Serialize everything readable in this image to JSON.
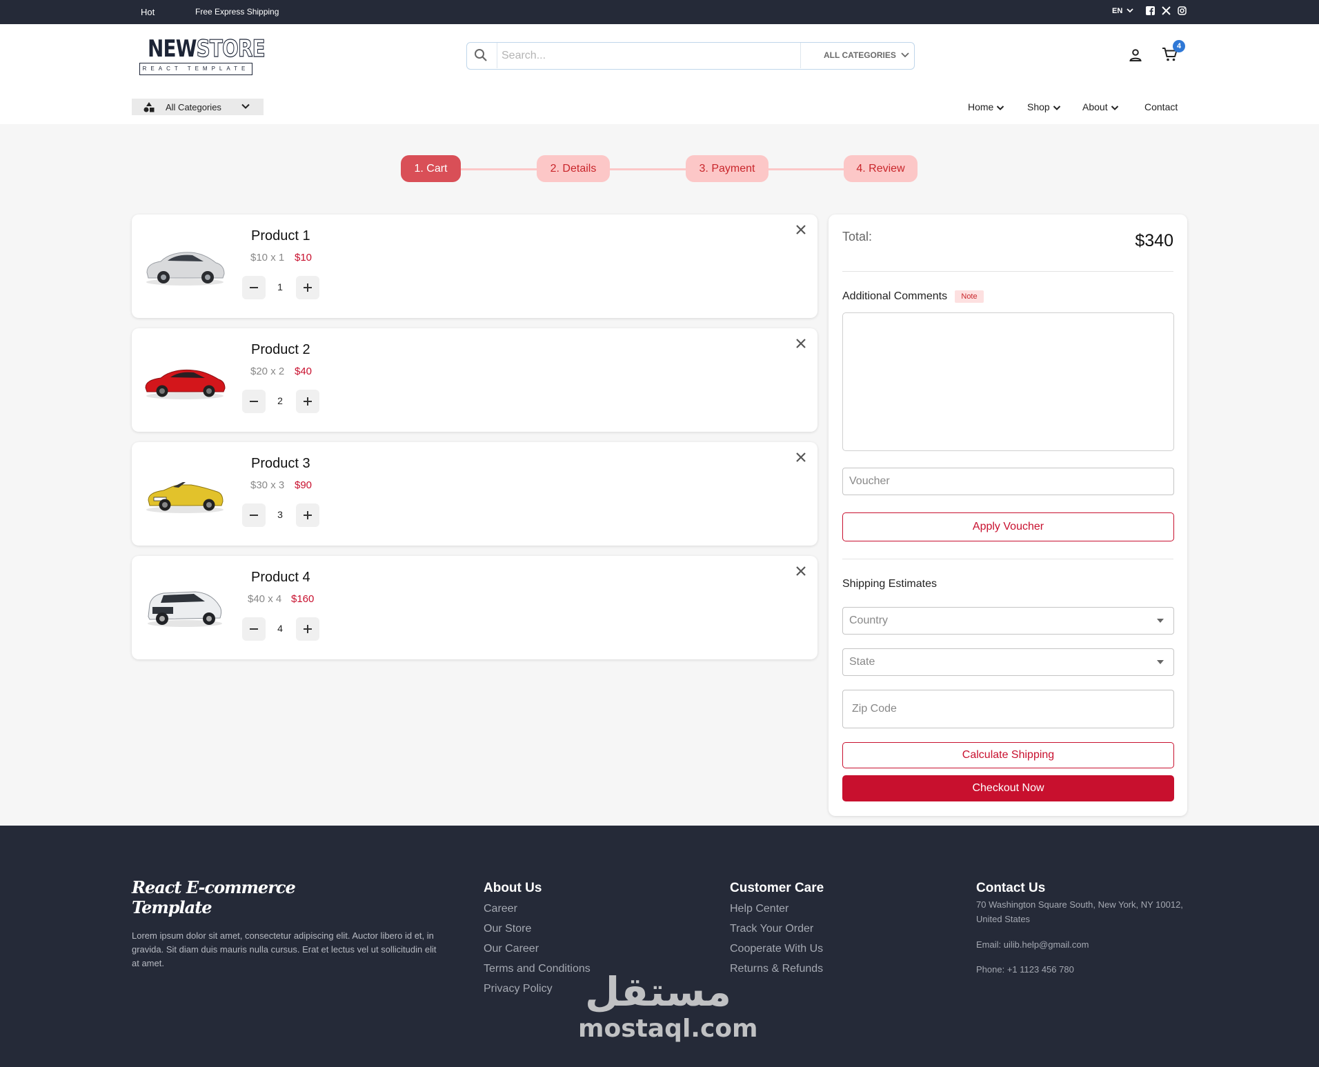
{
  "topbar": {
    "hot": "Hot",
    "shipping": "Free Express Shipping",
    "lang": "EN",
    "social_icons": [
      "facebook-icon",
      "x-icon",
      "instagram-icon"
    ]
  },
  "header": {
    "logo_new": "NEW",
    "logo_store": "STORE",
    "logo_tagline": "REACT TEMPLATE",
    "search_placeholder": "Search...",
    "search_category": "ALL CATEGORIES",
    "cart_count": "4"
  },
  "nav": {
    "all_categories": "All Categories",
    "items": [
      "Home",
      "Shop",
      "About",
      "Contact"
    ]
  },
  "steps": [
    "1. Cart",
    "2. Details",
    "3. Payment",
    "4. Review"
  ],
  "products": [
    {
      "name": "Product 1",
      "unit": "$10 x 1",
      "total": "$10",
      "qty": "1",
      "color": "#d9dadc"
    },
    {
      "name": "Product 2",
      "unit": "$20 x 2",
      "total": "$40",
      "qty": "2",
      "color": "#d3161b"
    },
    {
      "name": "Product 3",
      "unit": "$30 x 3",
      "total": "$90",
      "qty": "3",
      "color": "#e2c22b"
    },
    {
      "name": "Product 4",
      "unit": "$40 x 4",
      "total": "$160",
      "qty": "4",
      "color": "#eceef0"
    }
  ],
  "summary": {
    "total_label": "Total:",
    "total_value": "$340",
    "comments_label": "Additional Comments",
    "note_badge": "Note",
    "voucher_placeholder": "Voucher",
    "apply_voucher": "Apply Voucher",
    "shipping_label": "Shipping Estimates",
    "country": "Country",
    "state": "State",
    "zip_placeholder": "Zip Code",
    "calculate_shipping": "Calculate Shipping",
    "checkout": "Checkout Now"
  },
  "footer": {
    "brand_line1": "React E-commerce",
    "brand_line2": "Template",
    "description": "Lorem ipsum dolor sit amet, consectetur adipiscing elit. Auctor libero id et, in gravida. Sit diam duis mauris nulla cursus. Erat et lectus vel ut sollicitudin elit at amet.",
    "about_heading": "About Us",
    "about_links": [
      "Career",
      "Our Store",
      "Our Career",
      "Terms and Conditions",
      "Privacy Policy"
    ],
    "care_heading": "Customer Care",
    "care_links": [
      "Help Center",
      "Track Your Order",
      "Cooperate With Us",
      "Returns & Refunds"
    ],
    "contact_heading": "Contact Us",
    "address": "70 Washington Square South, New York, NY 10012, United States",
    "email": "Email: uilib.help@gmail.com",
    "phone": "Phone: +1 1123 456 780"
  },
  "watermark": {
    "arabic": "مستقل",
    "latin": "mostaql.com"
  },
  "colors": {
    "accent": "#c8102e",
    "topbar_bg": "#252a38",
    "step_active": "#d94f57",
    "step_inactive": "#fcc7c7",
    "badge": "#2f78d6"
  }
}
